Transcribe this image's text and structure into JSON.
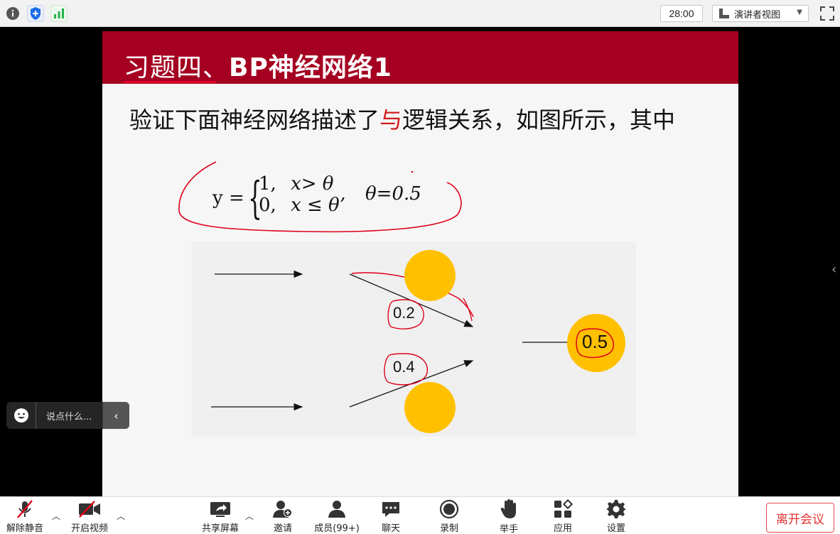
{
  "topbar": {
    "info_icon": "info-icon",
    "shield_icon": "shield-icon",
    "signal_icon": "signal-icon",
    "timer": "28:00",
    "view_selector": "演讲者视图",
    "fullscreen_icon": "fullscreen-icon"
  },
  "slide": {
    "title_cn": "习题四、",
    "title_en": "BP",
    "title_cn2": "神经网络",
    "title_num": "1",
    "text_before": "验证下面神经网络描述了",
    "text_red": "与",
    "text_after": "逻辑关系，如图所示，其中",
    "formula": {
      "y": "y =",
      "row1_val": "1,",
      "row1_cond": "x> θ",
      "row2_val": "0,",
      "row2_cond": "x ≤ θ’",
      "theta": "θ=0.5"
    },
    "diagram": {
      "weight_top": "0.2",
      "weight_bottom": "0.4",
      "output_threshold": "0.5"
    },
    "header_color": "#a50021",
    "node_color": "#ffc000",
    "annotation_color": "#e0001b"
  },
  "chat": {
    "placeholder": "说点什么..."
  },
  "toolbar": {
    "unmute": "解除静音",
    "start_video": "开启视频",
    "share_screen": "共享屏幕",
    "invite": "邀请",
    "participants": "成员(99+)",
    "chat": "聊天",
    "record": "录制",
    "raise_hand": "举手",
    "apps": "应用",
    "settings": "设置",
    "leave": "离开会议"
  }
}
